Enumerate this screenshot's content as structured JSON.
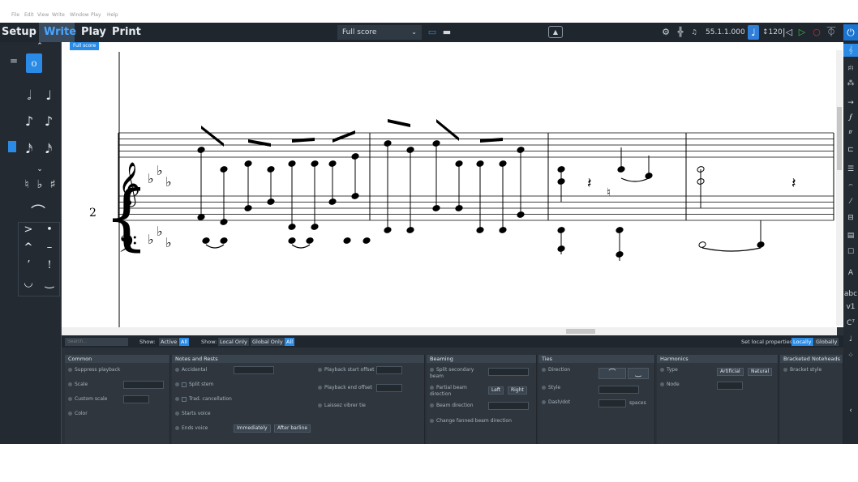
{
  "menu": [
    "File",
    "Edit",
    "View",
    "Write",
    "Window",
    "Play",
    "Help"
  ],
  "modes": [
    {
      "label": "Setup"
    },
    {
      "label": "Write"
    },
    {
      "label": "Play"
    },
    {
      "label": "Print"
    }
  ],
  "toolbar": {
    "layout": "Full score",
    "chev": "⌄",
    "icons": {
      "galley": "▭",
      "page": "▬"
    },
    "center": "▲",
    "mixer": "⚙",
    "faders": "╬",
    "rewind": "♫",
    "position": "55.1.1.000",
    "tempo_note": "♩",
    "tempo": "↕120",
    "prev": "|◁",
    "play": "▷",
    "record": "○",
    "metronome": "⏁",
    "power": "⏻"
  },
  "score": {
    "tab": "Full score",
    "system_number": "2",
    "treble_clef": "𝄞",
    "bass_clef": "𝄢",
    "flat": "♭",
    "rest": "𝄽"
  },
  "left_panel": {
    "up": "⌃",
    "down": "⌄",
    "tools": [
      "♩",
      "𝅗𝅥",
      "♪",
      "𝅘𝅥𝅯",
      "♮",
      "♭",
      "♯",
      "⌒",
      ">",
      "•",
      "^",
      "–",
      "ʼ",
      "!",
      "◡",
      "‿"
    ]
  },
  "right_panel": [
    "𝄞",
    "♯♮",
    "⁂",
    "→",
    "𝆑",
    "𝆖",
    "⊏",
    "☰",
    "𝄐",
    "⁄",
    "⊟",
    "▤",
    "☐",
    "A",
    "abc",
    "v1",
    "C⁷",
    "♩",
    "⁘",
    "‹"
  ],
  "filterbar": {
    "search_placeholder": "Search...",
    "show1": "Show:",
    "active": "Active",
    "all1": "All",
    "show2": "Show:",
    "local_only": "Local Only",
    "global_only": "Global Only",
    "all2": "All",
    "set_local": "Set local properties:",
    "locally": "Locally",
    "globally": "Globally"
  },
  "properties": {
    "common": {
      "title": "Common",
      "items": [
        "Suppress playback",
        "Scale",
        "Custom scale",
        "Color"
      ]
    },
    "notes": {
      "title": "Notes and Rests",
      "items": [
        "Accidental",
        "Split stem",
        "Trad. cancellation",
        "Starts voice",
        "Ends voice"
      ],
      "immediately": "Immediately",
      "after_barline": "After barline",
      "col2": [
        "Playback start offset",
        "Playback end offset",
        "Laissez vibrer tie"
      ]
    },
    "beaming": {
      "title": "Beaming",
      "items": [
        "Split secondary beam",
        "Partial beam direction",
        "Beam direction",
        "Change fanned beam direction"
      ],
      "left": "Left",
      "right": "Right"
    },
    "ties": {
      "title": "Ties",
      "items": [
        "Direction",
        "Style",
        "Dash/dot"
      ],
      "spaces": "spaces",
      "over": "⌒",
      "under": "‿"
    },
    "harmonics": {
      "title": "Harmonics",
      "items": [
        "Type",
        "Node"
      ],
      "artificial": "Artificial",
      "natural": "Natural"
    },
    "bracketed": {
      "title": "Bracketed Noteheads",
      "items": [
        "Bracket style"
      ]
    }
  },
  "colors": {
    "accent": "#2a8be6",
    "panel": "#2b3139",
    "toolbar": "#1f262e"
  }
}
